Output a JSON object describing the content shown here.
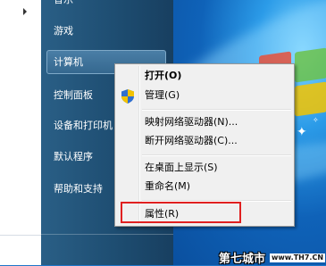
{
  "start_menu": {
    "items": [
      {
        "label": "音乐"
      },
      {
        "label": "游戏"
      },
      {
        "label": "计算机"
      },
      {
        "label": "控制面板"
      },
      {
        "label": "设备和打印机"
      },
      {
        "label": "默认程序"
      },
      {
        "label": "帮助和支持"
      }
    ]
  },
  "context_menu": {
    "items": [
      {
        "label": "打开(O)"
      },
      {
        "label": "管理(G)"
      },
      {
        "label": "映射网络驱动器(N)..."
      },
      {
        "label": "断开网络驱动器(C)..."
      },
      {
        "label": "在桌面上显示(S)"
      },
      {
        "label": "重命名(M)"
      },
      {
        "label": "属性(R)"
      }
    ]
  },
  "watermark": {
    "text": "第七城市",
    "url": "www.TH7.CN"
  },
  "colors": {
    "highlight_box": "#e02020"
  }
}
